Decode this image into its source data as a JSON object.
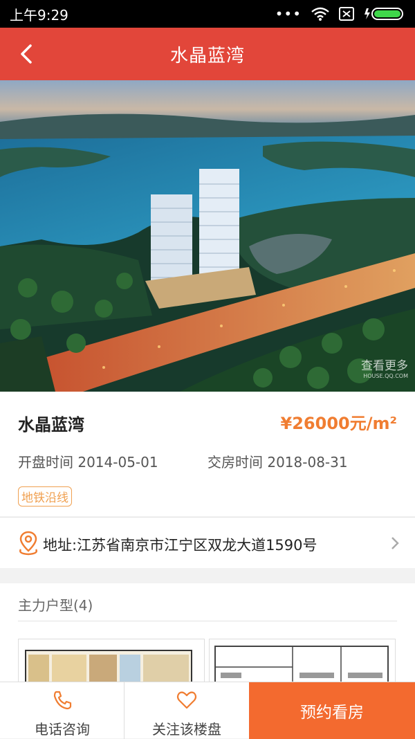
{
  "status_bar": {
    "time": "上午9:29"
  },
  "header": {
    "title": "水晶蓝湾"
  },
  "hero_image": {
    "watermark": "查看更多",
    "watermark_sub": "HOUSE.QQ.COM"
  },
  "property": {
    "name": "水晶蓝湾",
    "price": "¥26000元/m²",
    "open_date": "开盘时间 2014-05-01",
    "delivery_date": "交房时间 2018-08-31",
    "tag": "地铁沿线",
    "address": "地址:江苏省南京市江宁区双龙大道1590号"
  },
  "units": {
    "title": "主力户型(4)"
  },
  "bottom_bar": {
    "phone_label": "电话咨询",
    "follow_label": "关注该楼盘",
    "book_label": "预约看房"
  },
  "colors": {
    "accent": "#e2463a",
    "price": "#f07d31",
    "book": "#f36a2f"
  }
}
